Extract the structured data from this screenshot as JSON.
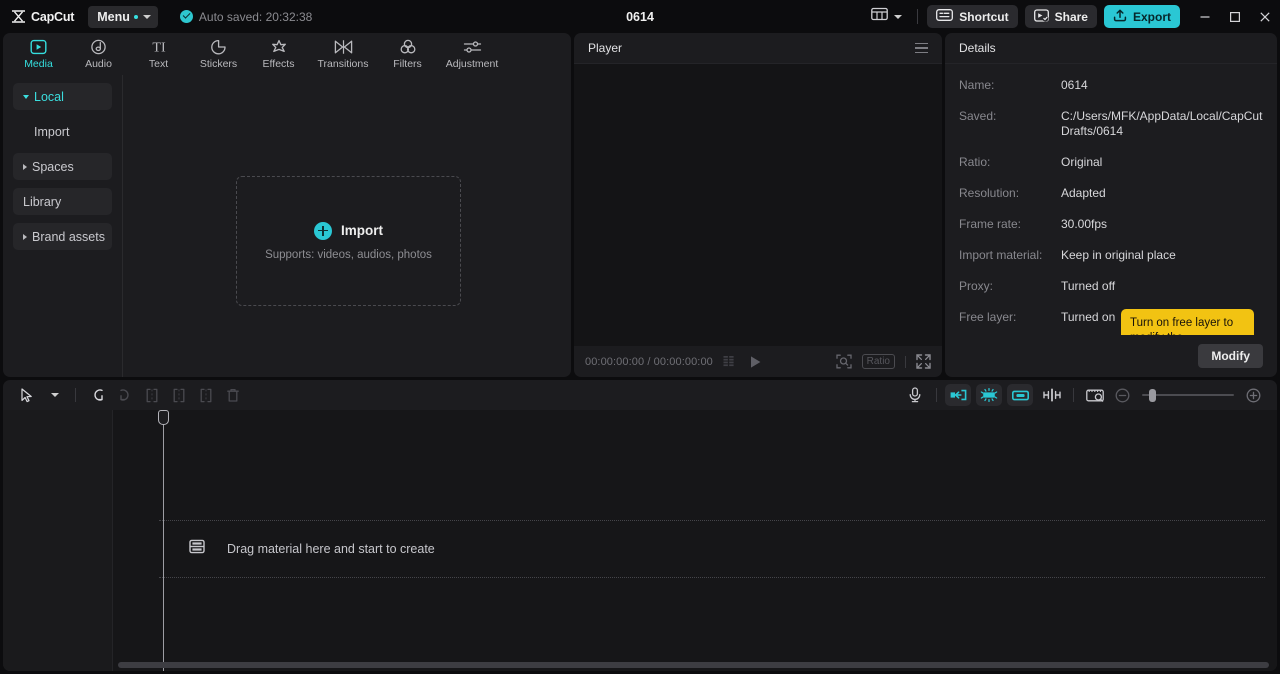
{
  "titlebar": {
    "brand": "CapCut",
    "menu_label": "Menu",
    "autosave_label": "Auto saved: 20:32:38",
    "doc_title": "0614",
    "shortcut_label": "Shortcut",
    "share_label": "Share",
    "export_label": "Export",
    "layout_icon": "layout-grid-icon",
    "minimize_icon": "minimize-icon",
    "maximize_icon": "maximize-icon",
    "close_icon": "close-icon",
    "accent_color": "#2ac7d4"
  },
  "tabs": [
    {
      "label": "Media",
      "icon": "media-icon",
      "active": true
    },
    {
      "label": "Audio",
      "icon": "audio-icon",
      "active": false
    },
    {
      "label": "Text",
      "icon": "text-icon",
      "active": false
    },
    {
      "label": "Stickers",
      "icon": "stickers-icon",
      "active": false
    },
    {
      "label": "Effects",
      "icon": "effects-icon",
      "active": false
    },
    {
      "label": "Transitions",
      "icon": "transitions-icon",
      "active": false
    },
    {
      "label": "Filters",
      "icon": "filters-icon",
      "active": false
    },
    {
      "label": "Adjustment",
      "icon": "adjustment-icon",
      "active": false
    }
  ],
  "sidebar": {
    "items": [
      {
        "label": "Local",
        "expanded": true,
        "active": true,
        "boxed": true
      },
      {
        "label": "Import",
        "sub": true,
        "boxed": false
      },
      {
        "label": "Spaces",
        "expanded": false,
        "boxed": true
      },
      {
        "label": "Library",
        "boxed": true
      },
      {
        "label": "Brand assets",
        "expanded": false,
        "boxed": true
      }
    ]
  },
  "dropzone": {
    "title": "Import",
    "subtitle": "Supports: videos, audios, photos"
  },
  "player": {
    "header": "Player",
    "current_time": "00:00:00:00",
    "total_time": "00:00:00:00",
    "timecode": "00:00:00:00 / 00:00:00:00",
    "ratio_label": "Ratio"
  },
  "details": {
    "header": "Details",
    "rows": [
      {
        "label": "Name:",
        "value": "0614"
      },
      {
        "label": "Saved:",
        "value": "C:/Users/MFK/AppData/Local/CapCut Drafts/0614"
      },
      {
        "label": "Ratio:",
        "value": "Original"
      },
      {
        "label": "Resolution:",
        "value": "Adapted"
      },
      {
        "label": "Frame rate:",
        "value": "30.00fps"
      },
      {
        "label": "Import material:",
        "value": "Keep in original place"
      },
      {
        "label": "Proxy:",
        "value": "Turned off"
      },
      {
        "label": "Free layer:",
        "value": "Turned on"
      }
    ],
    "tooltip": "Turn on free layer to modify the relationship between tracks by changing",
    "modify_label": "Modify"
  },
  "timeline": {
    "placeholder": "Drag material here and start to create",
    "tools": [
      {
        "name": "select-tool",
        "state": "active"
      },
      {
        "name": "undo",
        "state": "active"
      },
      {
        "name": "redo",
        "state": "disabled"
      },
      {
        "name": "split",
        "state": "disabled"
      },
      {
        "name": "trim-left",
        "state": "disabled"
      },
      {
        "name": "trim-right",
        "state": "disabled"
      },
      {
        "name": "delete",
        "state": "disabled"
      }
    ],
    "right_tools": [
      {
        "name": "record-voiceover",
        "state": "normal"
      },
      {
        "name": "auto-attach",
        "state": "on"
      },
      {
        "name": "magnetic-snap",
        "state": "on"
      },
      {
        "name": "link-carrier",
        "state": "on"
      },
      {
        "name": "adsorption",
        "state": "normal"
      },
      {
        "name": "edit-thumbnail",
        "state": "normal"
      }
    ],
    "zoom_percent": 8
  }
}
